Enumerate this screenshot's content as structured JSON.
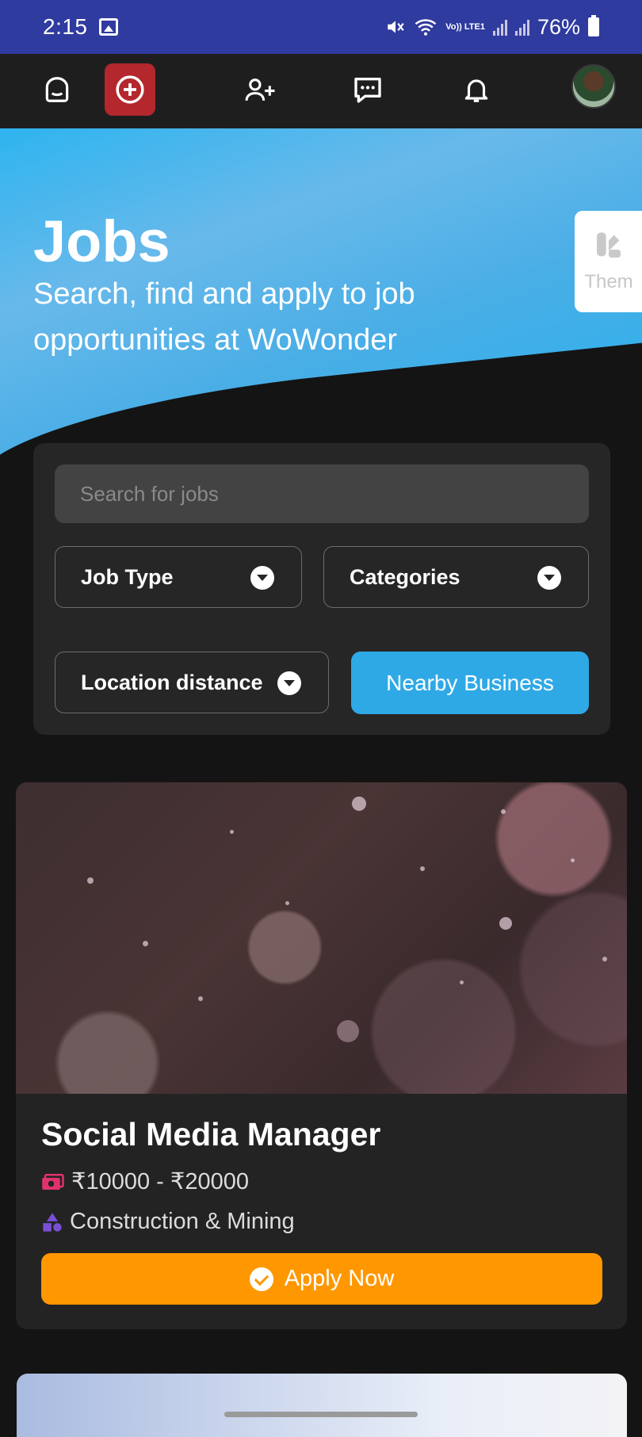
{
  "status_bar": {
    "time": "2:15",
    "battery": "76%",
    "network": "Vo)) LTE1"
  },
  "nav": {
    "icons": [
      "home-icon",
      "add-circle-icon",
      "add-user-icon",
      "chat-icon",
      "bell-icon"
    ],
    "accent": "#b3272d"
  },
  "hero": {
    "title": "Jobs",
    "subtitle": "Search, find and apply to job opportunities at WoWonder",
    "theme_label": "Them"
  },
  "filters": {
    "search_placeholder": "Search for jobs",
    "job_type": "Job Type",
    "categories": "Categories",
    "location_distance": "Location distance",
    "nearby_button": "Nearby Business"
  },
  "job": {
    "title": "Social Media Manager",
    "salary": "₹10000 - ₹20000",
    "category": "Construction & Mining",
    "apply_label": "Apply Now",
    "apply_color": "#ff9800"
  }
}
